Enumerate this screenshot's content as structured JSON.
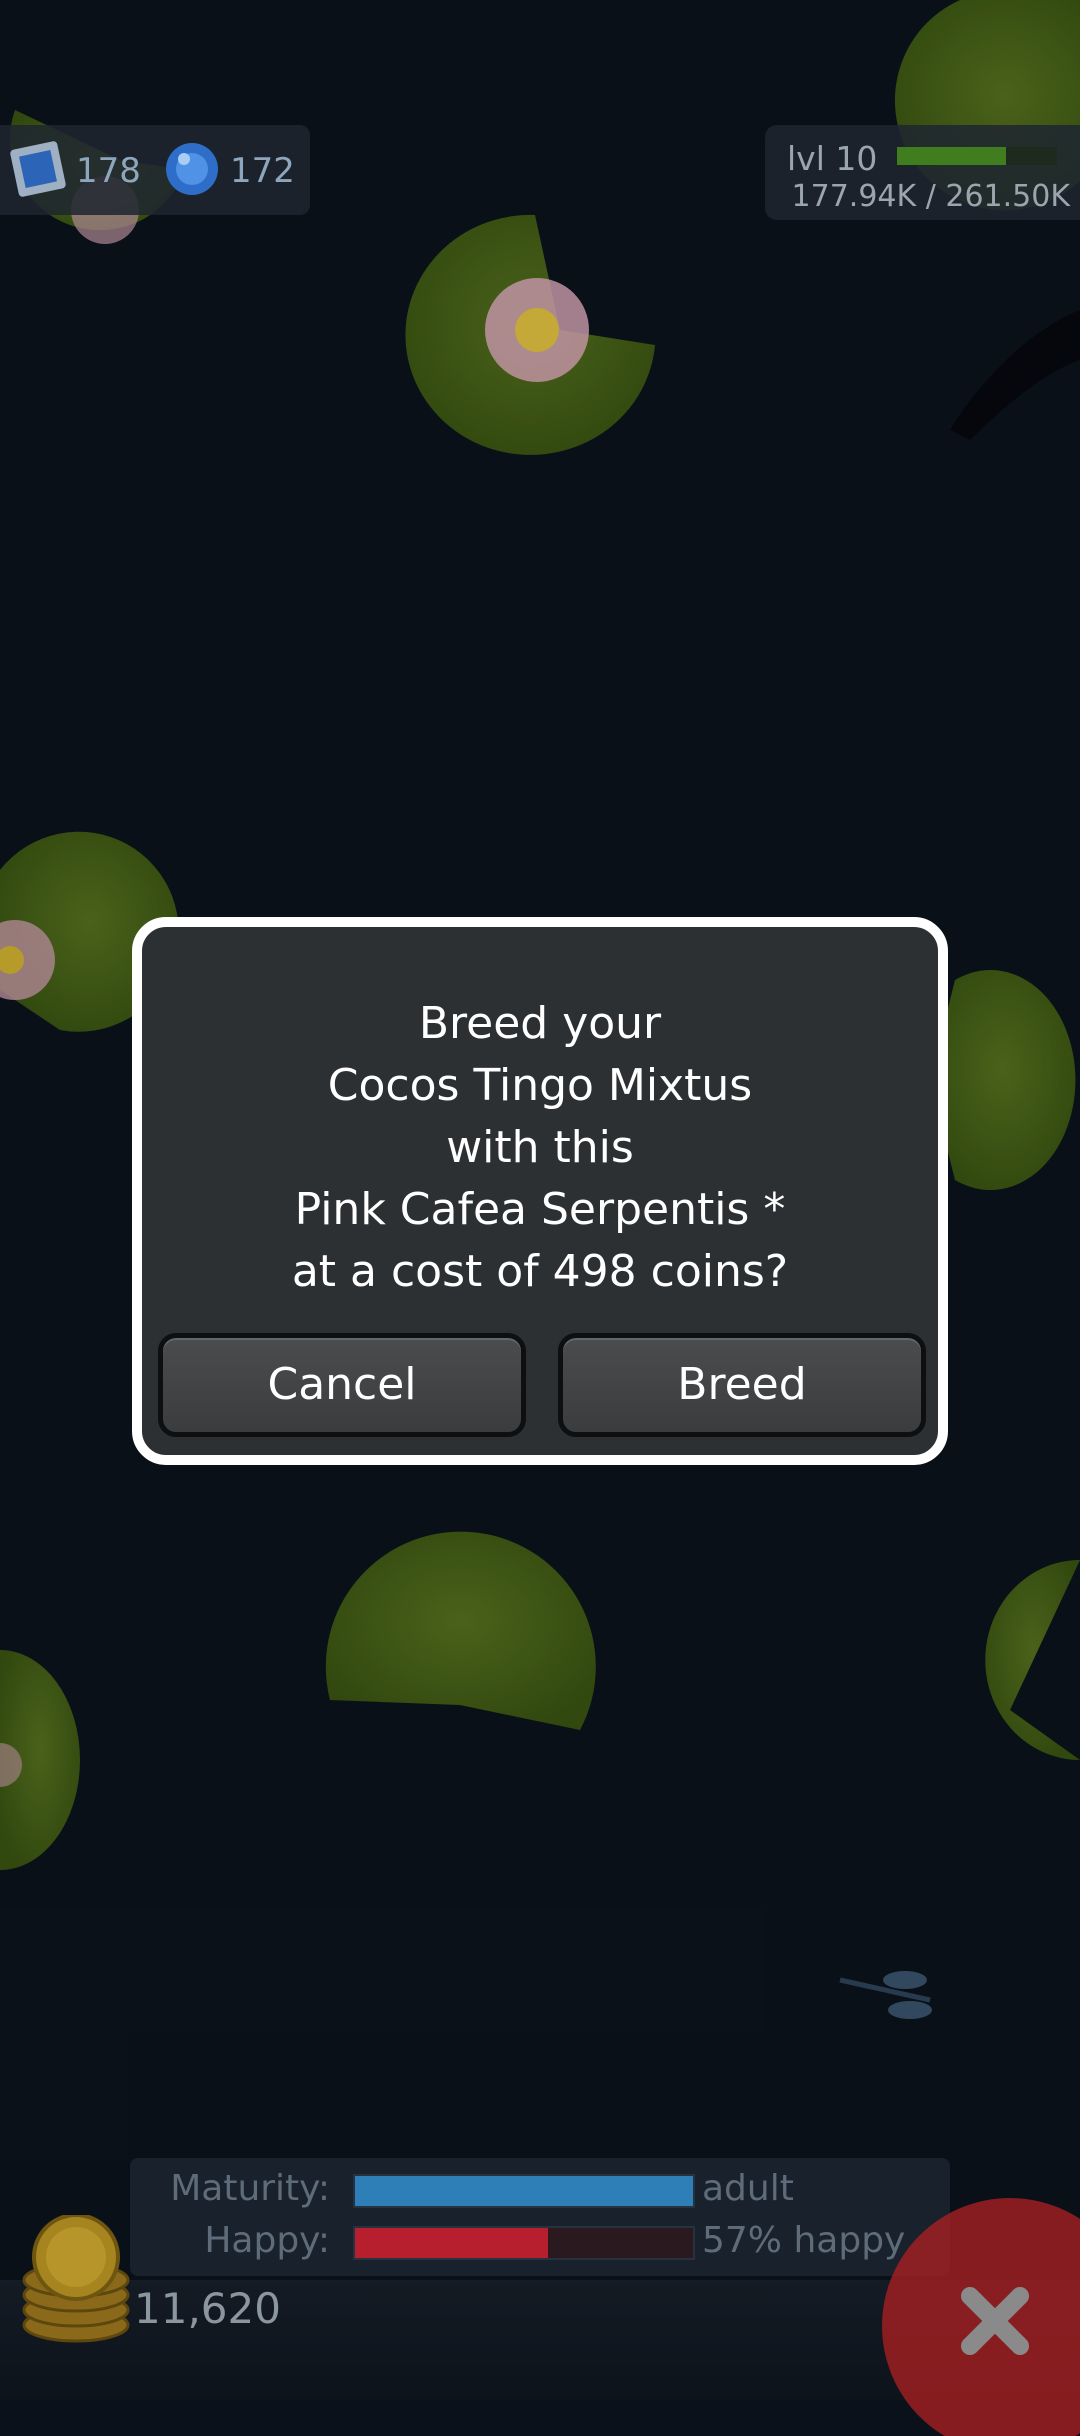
{
  "hud": {
    "stamps": "178",
    "gems": "172",
    "level": "lvl 10",
    "xp_text": "177.94K / 261.50K",
    "xp_progress": 0.68
  },
  "dialog": {
    "lines": [
      "Breed your",
      "Cocos Tingo Mixtus",
      "with this",
      "Pink Cafea Serpentis *",
      "at a cost of 498 coins?"
    ],
    "cancel_label": "Cancel",
    "breed_label": "Breed"
  },
  "status": {
    "maturity_label": "Maturity:",
    "maturity_value": "adult",
    "maturity_progress": 1.0,
    "happy_label": "Happy:",
    "happy_value": "57% happy",
    "happy_progress": 0.57
  },
  "coins": "11,620",
  "colors": {
    "maturity_bar": "#2e7fb8",
    "happy_bar": "#b81f2e",
    "close_button": "#b02021"
  }
}
